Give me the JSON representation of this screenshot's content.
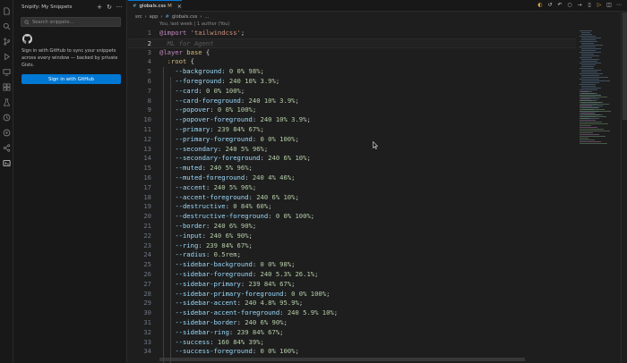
{
  "sidebar": {
    "title": "Snipify: My Snippets",
    "actions": [
      {
        "name": "new-snippet-button",
        "glyph": "+"
      },
      {
        "name": "refresh-button",
        "glyph": "↻"
      },
      {
        "name": "more-actions-button",
        "glyph": "···"
      }
    ],
    "search_placeholder": "Search snippets...",
    "signin_text": "Sign in with GitHub to sync your snippets across every window — backed by private Gists.",
    "signin_button": "Sign in with GitHub"
  },
  "tab": {
    "file_icon": "#",
    "filename": "globals.css",
    "modified": "M",
    "close": "×"
  },
  "breadcrumb": {
    "parts": [
      "src",
      "app",
      "globals.css",
      "..."
    ],
    "separator": "›"
  },
  "blame": "You, last week | 1 author (You)",
  "ghost_text": "ML for Agent",
  "colors": {
    "accent": "#0078d4",
    "keyword": "#c586c0",
    "string": "#ce9178",
    "property": "#9cdcfe",
    "value": "#b5cea8"
  },
  "code_lines": [
    {
      "n": "1",
      "tokens": [
        [
          "k",
          "@import"
        ],
        [
          "pu",
          " "
        ],
        [
          "s",
          "'tailwindcss'"
        ],
        [
          "pu",
          ";"
        ]
      ]
    },
    {
      "n": "2",
      "tokens": [
        [
          "ghost",
          "  ML for Agent"
        ]
      ],
      "current": true
    },
    {
      "n": "3",
      "tokens": [
        [
          "k",
          "@layer"
        ],
        [
          "pu",
          " "
        ],
        [
          "sel",
          "base"
        ],
        [
          "pu",
          " {"
        ]
      ]
    },
    {
      "n": "4",
      "tokens": [
        [
          "pu",
          "  "
        ],
        [
          "sel",
          ":root"
        ],
        [
          "pu",
          " {"
        ]
      ]
    },
    {
      "n": "5",
      "tokens": [
        [
          "pu",
          "    "
        ],
        [
          "p",
          "--background"
        ],
        [
          "pu",
          ": "
        ],
        [
          "v",
          "0 0% 98%"
        ],
        [
          "pu",
          ";"
        ]
      ]
    },
    {
      "n": "6",
      "tokens": [
        [
          "pu",
          "    "
        ],
        [
          "p",
          "--foreground"
        ],
        [
          "pu",
          ": "
        ],
        [
          "v",
          "240 10% 3.9%"
        ],
        [
          "pu",
          ";"
        ]
      ]
    },
    {
      "n": "7",
      "tokens": [
        [
          "pu",
          "    "
        ],
        [
          "p",
          "--card"
        ],
        [
          "pu",
          ": "
        ],
        [
          "v",
          "0 0% 100%"
        ],
        [
          "pu",
          ";"
        ]
      ]
    },
    {
      "n": "8",
      "tokens": [
        [
          "pu",
          "    "
        ],
        [
          "p",
          "--card-foreground"
        ],
        [
          "pu",
          ": "
        ],
        [
          "v",
          "240 10% 3.9%"
        ],
        [
          "pu",
          ";"
        ]
      ]
    },
    {
      "n": "9",
      "tokens": [
        [
          "pu",
          "    "
        ],
        [
          "p",
          "--popover"
        ],
        [
          "pu",
          ": "
        ],
        [
          "v",
          "0 0% 100%"
        ],
        [
          "pu",
          ";"
        ]
      ]
    },
    {
      "n": "10",
      "tokens": [
        [
          "pu",
          "    "
        ],
        [
          "p",
          "--popover-foreground"
        ],
        [
          "pu",
          ": "
        ],
        [
          "v",
          "240 10% 3.9%"
        ],
        [
          "pu",
          ";"
        ]
      ]
    },
    {
      "n": "11",
      "tokens": [
        [
          "pu",
          "    "
        ],
        [
          "p",
          "--primary"
        ],
        [
          "pu",
          ": "
        ],
        [
          "v",
          "239 84% 67%"
        ],
        [
          "pu",
          ";"
        ]
      ]
    },
    {
      "n": "12",
      "tokens": [
        [
          "pu",
          "    "
        ],
        [
          "p",
          "--primary-foreground"
        ],
        [
          "pu",
          ": "
        ],
        [
          "v",
          "0 0% 100%"
        ],
        [
          "pu",
          ";"
        ]
      ]
    },
    {
      "n": "13",
      "tokens": [
        [
          "pu",
          "    "
        ],
        [
          "p",
          "--secondary"
        ],
        [
          "pu",
          ": "
        ],
        [
          "v",
          "240 5% 96%"
        ],
        [
          "pu",
          ";"
        ]
      ]
    },
    {
      "n": "14",
      "tokens": [
        [
          "pu",
          "    "
        ],
        [
          "p",
          "--secondary-foreground"
        ],
        [
          "pu",
          ": "
        ],
        [
          "v",
          "240 6% 10%"
        ],
        [
          "pu",
          ";"
        ]
      ]
    },
    {
      "n": "15",
      "tokens": [
        [
          "pu",
          "    "
        ],
        [
          "p",
          "--muted"
        ],
        [
          "pu",
          ": "
        ],
        [
          "v",
          "240 5% 96%"
        ],
        [
          "pu",
          ";"
        ]
      ]
    },
    {
      "n": "16",
      "tokens": [
        [
          "pu",
          "    "
        ],
        [
          "p",
          "--muted-foreground"
        ],
        [
          "pu",
          ": "
        ],
        [
          "v",
          "240 4% 46%"
        ],
        [
          "pu",
          ";"
        ]
      ]
    },
    {
      "n": "17",
      "tokens": [
        [
          "pu",
          "    "
        ],
        [
          "p",
          "--accent"
        ],
        [
          "pu",
          ": "
        ],
        [
          "v",
          "240 5% 96%"
        ],
        [
          "pu",
          ";"
        ]
      ]
    },
    {
      "n": "18",
      "tokens": [
        [
          "pu",
          "    "
        ],
        [
          "p",
          "--accent-foreground"
        ],
        [
          "pu",
          ": "
        ],
        [
          "v",
          "240 6% 10%"
        ],
        [
          "pu",
          ";"
        ]
      ]
    },
    {
      "n": "19",
      "tokens": [
        [
          "pu",
          "    "
        ],
        [
          "p",
          "--destructive"
        ],
        [
          "pu",
          ": "
        ],
        [
          "v",
          "0 84% 60%"
        ],
        [
          "pu",
          ";"
        ]
      ]
    },
    {
      "n": "20",
      "tokens": [
        [
          "pu",
          "    "
        ],
        [
          "p",
          "--destructive-foreground"
        ],
        [
          "pu",
          ": "
        ],
        [
          "v",
          "0 0% 100%"
        ],
        [
          "pu",
          ";"
        ]
      ]
    },
    {
      "n": "21",
      "tokens": [
        [
          "pu",
          "    "
        ],
        [
          "p",
          "--border"
        ],
        [
          "pu",
          ": "
        ],
        [
          "v",
          "240 6% 90%"
        ],
        [
          "pu",
          ";"
        ]
      ]
    },
    {
      "n": "22",
      "tokens": [
        [
          "pu",
          "    "
        ],
        [
          "p",
          "--input"
        ],
        [
          "pu",
          ": "
        ],
        [
          "v",
          "240 6% 90%"
        ],
        [
          "pu",
          ";"
        ]
      ]
    },
    {
      "n": "23",
      "tokens": [
        [
          "pu",
          "    "
        ],
        [
          "p",
          "--ring"
        ],
        [
          "pu",
          ": "
        ],
        [
          "v",
          "239 84% 67%"
        ],
        [
          "pu",
          ";"
        ]
      ]
    },
    {
      "n": "24",
      "tokens": [
        [
          "pu",
          "    "
        ],
        [
          "p",
          "--radius"
        ],
        [
          "pu",
          ": "
        ],
        [
          "v",
          "0.5rem"
        ],
        [
          "pu",
          ";"
        ]
      ]
    },
    {
      "n": "25",
      "tokens": [
        [
          "pu",
          "    "
        ],
        [
          "p",
          "--sidebar-background"
        ],
        [
          "pu",
          ": "
        ],
        [
          "v",
          "0 0% 98%"
        ],
        [
          "pu",
          ";"
        ]
      ]
    },
    {
      "n": "26",
      "tokens": [
        [
          "pu",
          "    "
        ],
        [
          "p",
          "--sidebar-foreground"
        ],
        [
          "pu",
          ": "
        ],
        [
          "v",
          "240 5.3% 26.1%"
        ],
        [
          "pu",
          ";"
        ]
      ]
    },
    {
      "n": "27",
      "tokens": [
        [
          "pu",
          "    "
        ],
        [
          "p",
          "--sidebar-primary"
        ],
        [
          "pu",
          ": "
        ],
        [
          "v",
          "239 84% 67%"
        ],
        [
          "pu",
          ";"
        ]
      ]
    },
    {
      "n": "28",
      "tokens": [
        [
          "pu",
          "    "
        ],
        [
          "p",
          "--sidebar-primary-foreground"
        ],
        [
          "pu",
          ": "
        ],
        [
          "v",
          "0 0% 100%"
        ],
        [
          "pu",
          ";"
        ]
      ]
    },
    {
      "n": "29",
      "tokens": [
        [
          "pu",
          "    "
        ],
        [
          "p",
          "--sidebar-accent"
        ],
        [
          "pu",
          ": "
        ],
        [
          "v",
          "240 4.8% 95.9%"
        ],
        [
          "pu",
          ";"
        ]
      ]
    },
    {
      "n": "30",
      "tokens": [
        [
          "pu",
          "    "
        ],
        [
          "p",
          "--sidebar-accent-foreground"
        ],
        [
          "pu",
          ": "
        ],
        [
          "v",
          "240 5.9% 10%"
        ],
        [
          "pu",
          ";"
        ]
      ]
    },
    {
      "n": "31",
      "tokens": [
        [
          "pu",
          "    "
        ],
        [
          "p",
          "--sidebar-border"
        ],
        [
          "pu",
          ": "
        ],
        [
          "v",
          "240 6% 90%"
        ],
        [
          "pu",
          ";"
        ]
      ]
    },
    {
      "n": "32",
      "tokens": [
        [
          "pu",
          "    "
        ],
        [
          "p",
          "--sidebar-ring"
        ],
        [
          "pu",
          ": "
        ],
        [
          "v",
          "239 84% 67%"
        ],
        [
          "pu",
          ";"
        ]
      ]
    },
    {
      "n": "33",
      "tokens": [
        [
          "pu",
          "    "
        ],
        [
          "p",
          "--success"
        ],
        [
          "pu",
          ": "
        ],
        [
          "v",
          "160 84% 39%"
        ],
        [
          "pu",
          ";"
        ]
      ]
    },
    {
      "n": "34",
      "tokens": [
        [
          "pu",
          "    "
        ],
        [
          "p",
          "--success-foreground"
        ],
        [
          "pu",
          ": "
        ],
        [
          "v",
          "0 0% 100%"
        ],
        [
          "pu",
          ";"
        ]
      ]
    }
  ]
}
